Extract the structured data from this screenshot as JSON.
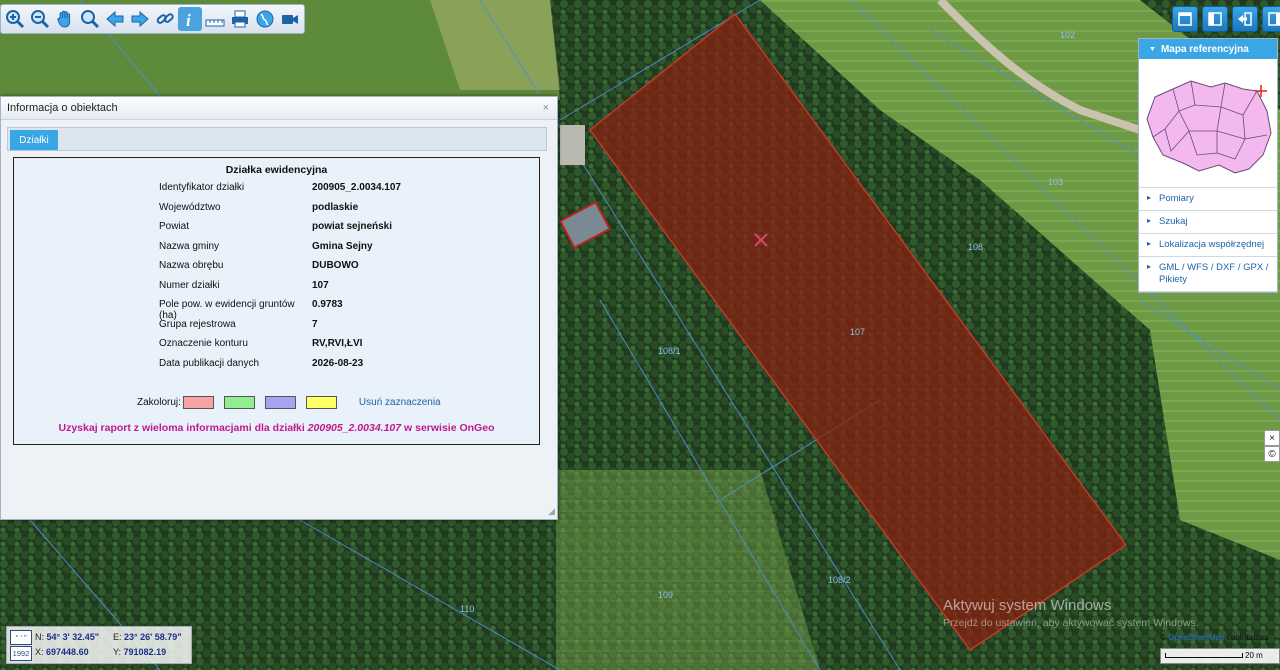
{
  "toolbar": {
    "tools": [
      "zoom-in-icon",
      "zoom-out-icon",
      "pan-hand-icon",
      "zoom-window-icon",
      "back-arrow-icon",
      "forward-arrow-icon",
      "link-icon",
      "info-icon",
      "measure-icon",
      "print-icon",
      "globe-icon",
      "camera-icon"
    ],
    "active_tool": "info-icon"
  },
  "map_labels": [
    "102",
    "103",
    "108",
    "107",
    "108/1",
    "108/2",
    "109",
    "110"
  ],
  "reference_panel": {
    "title": "Mapa referencyjna",
    "items": [
      "Pomiary",
      "Szukaj",
      "Lokalizacja współrzędnej",
      "GML / WFS / DXF / GPX / Pikiety"
    ]
  },
  "info_window": {
    "title": "Informacja o obiektach",
    "close_glyph": "×",
    "tab": "Działki",
    "section_title": "Działka ewidencyjna",
    "rows": [
      {
        "k": "Identyfikator działki",
        "v": "200905_2.0034.107"
      },
      {
        "k": "Województwo",
        "v": "podlaskie"
      },
      {
        "k": "Powiat",
        "v": "powiat sejneński"
      },
      {
        "k": "Nazwa gminy",
        "v": "Gmina Sejny"
      },
      {
        "k": "Nazwa obrębu",
        "v": "DUBOWO"
      },
      {
        "k": "Numer działki",
        "v": "107"
      },
      {
        "k": "Pole pow. w ewidencji gruntów (ha)",
        "v": "0.9783"
      },
      {
        "k": "Grupa rejestrowa",
        "v": "7"
      },
      {
        "k": "Oznaczenie konturu",
        "v": "RV,RVI,ŁVI"
      },
      {
        "k": "Data publikacji danych",
        "v": "2026-08-23"
      }
    ],
    "color_label": "Zakoloruj:",
    "swatches": [
      "#f7a3a3",
      "#90ee90",
      "#a9a2f2",
      "#ffff66"
    ],
    "clear_label": "Usuń zaznaczenia",
    "report_prefix": "Uzyskaj raport z wieloma informacjami dla działki ",
    "report_id": "200905_2.0034.107",
    "report_suffix": " w serwisie OnGeo"
  },
  "coords": {
    "n_label": "N:",
    "n_value": "54° 3' 32.45\"",
    "e_label": "E:",
    "e_value": "23° 26' 58.79\"",
    "x_label": "X:",
    "x_value": "697448.60",
    "y_label": "Y:",
    "y_value": "791082.19",
    "system": "1992",
    "deg_icon": "° ' \""
  },
  "watermark": {
    "line1": "Aktywuj system Windows",
    "line2": "Przejdź do ustawień, aby aktywować system Windows."
  },
  "attribution": {
    "prefix": "© ",
    "osm": "OpenStreetMap",
    "suffix": " contributors"
  },
  "scale": "20 m",
  "side_buttons": [
    "×",
    "©"
  ]
}
